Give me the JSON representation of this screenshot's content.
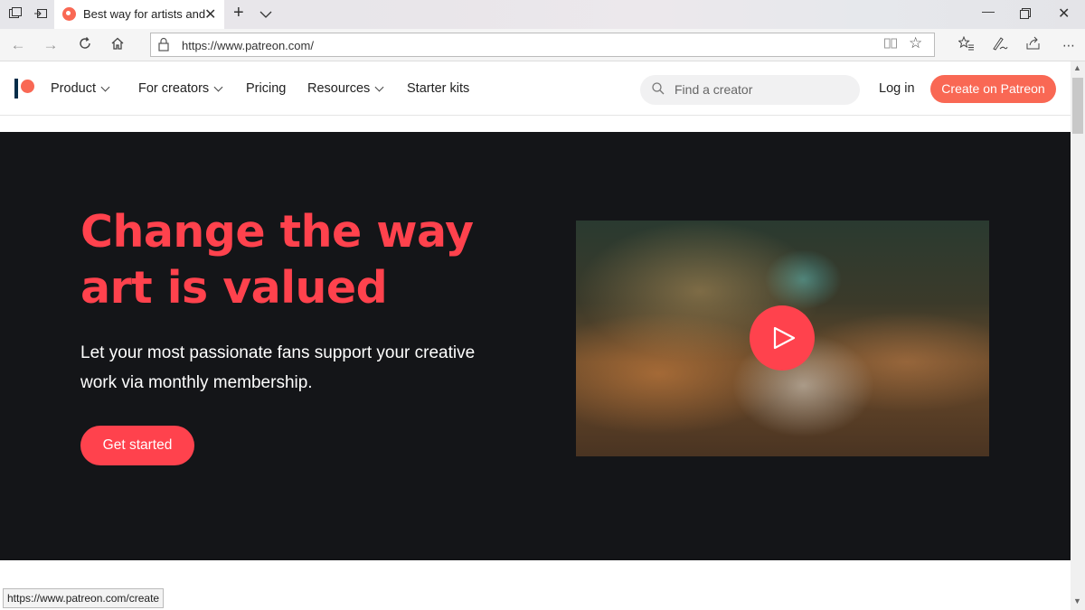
{
  "browser": {
    "tab": {
      "title": "Best way for artists and"
    },
    "address": {
      "url": "https://www.patreon.com/"
    },
    "status_url": "https://www.patreon.com/create"
  },
  "header": {
    "nav": [
      {
        "label": "Product"
      },
      {
        "label": "For creators"
      },
      {
        "label": "Pricing"
      },
      {
        "label": "Resources"
      },
      {
        "label": "Starter kits"
      }
    ],
    "search_placeholder": "Find a creator",
    "login_label": "Log in",
    "create_label": "Create on Patreon"
  },
  "hero": {
    "title_line1": "Change the way",
    "title_line2": "art is valued",
    "subtitle": "Let your most passionate fans support your creative work via monthly membership.",
    "cta_label": "Get started"
  },
  "colors": {
    "brand_coral": "#f96854",
    "brand_navy": "#052d49",
    "hero_accent": "#ff424d",
    "hero_bg": "#141518"
  }
}
